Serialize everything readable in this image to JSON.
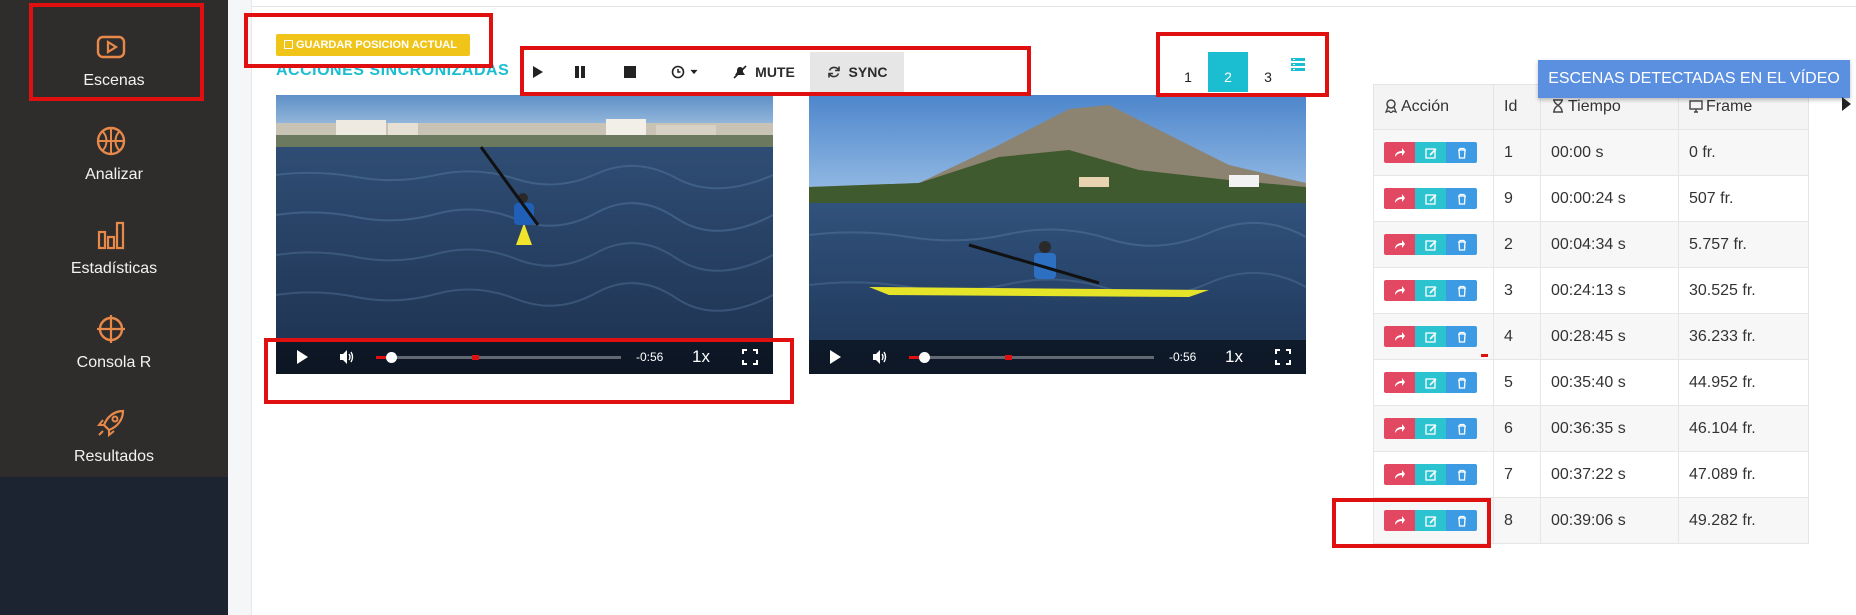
{
  "sidebar": {
    "items": [
      {
        "label": "Escenas",
        "icon": "play-square-icon"
      },
      {
        "label": "Analizar",
        "icon": "basketball-icon"
      },
      {
        "label": "Estadísticas",
        "icon": "bar-chart-icon"
      },
      {
        "label": "Consola R",
        "icon": "crosshair-icon"
      },
      {
        "label": "Resultados",
        "icon": "rocket-icon"
      }
    ]
  },
  "main": {
    "save_label": "GUARDAR POSICION ACTUAL",
    "section_title": "ACCIONES SINCRONIZADAS",
    "toolbar": {
      "mute_label": "MUTE",
      "sync_label": "SYNC"
    },
    "pager": {
      "pages": [
        "1",
        "2",
        "3"
      ],
      "active": "2"
    },
    "videos": [
      {
        "time": "-0:56",
        "rate": "1x",
        "played": 0.05
      },
      {
        "time": "-0:56",
        "rate": "1x",
        "played": 0.05
      }
    ]
  },
  "scenes": {
    "button_label": "ESCENAS DETECTADAS EN EL VÍDEO",
    "headers": {
      "accion": "Acción",
      "id": "Id",
      "tiempo": "Tiempo",
      "frame": "Frame"
    },
    "rows": [
      {
        "id": "1",
        "tiempo": "00:00 s",
        "frame": "0 fr."
      },
      {
        "id": "9",
        "tiempo": "00:00:24 s",
        "frame": "507 fr."
      },
      {
        "id": "2",
        "tiempo": "00:04:34 s",
        "frame": "5.757 fr."
      },
      {
        "id": "3",
        "tiempo": "00:24:13 s",
        "frame": "30.525 fr."
      },
      {
        "id": "4",
        "tiempo": "00:28:45 s",
        "frame": "36.233 fr."
      },
      {
        "id": "5",
        "tiempo": "00:35:40 s",
        "frame": "44.952 fr."
      },
      {
        "id": "6",
        "tiempo": "00:36:35 s",
        "frame": "46.104 fr."
      },
      {
        "id": "7",
        "tiempo": "00:37:22 s",
        "frame": "47.089 fr."
      },
      {
        "id": "8",
        "tiempo": "00:39:06 s",
        "frame": "49.282 fr."
      }
    ]
  },
  "colors": {
    "accent": "#1bbdd0",
    "highlight": "#e01010",
    "save": "#f0c419",
    "scenes_button": "#5b8fdf"
  }
}
